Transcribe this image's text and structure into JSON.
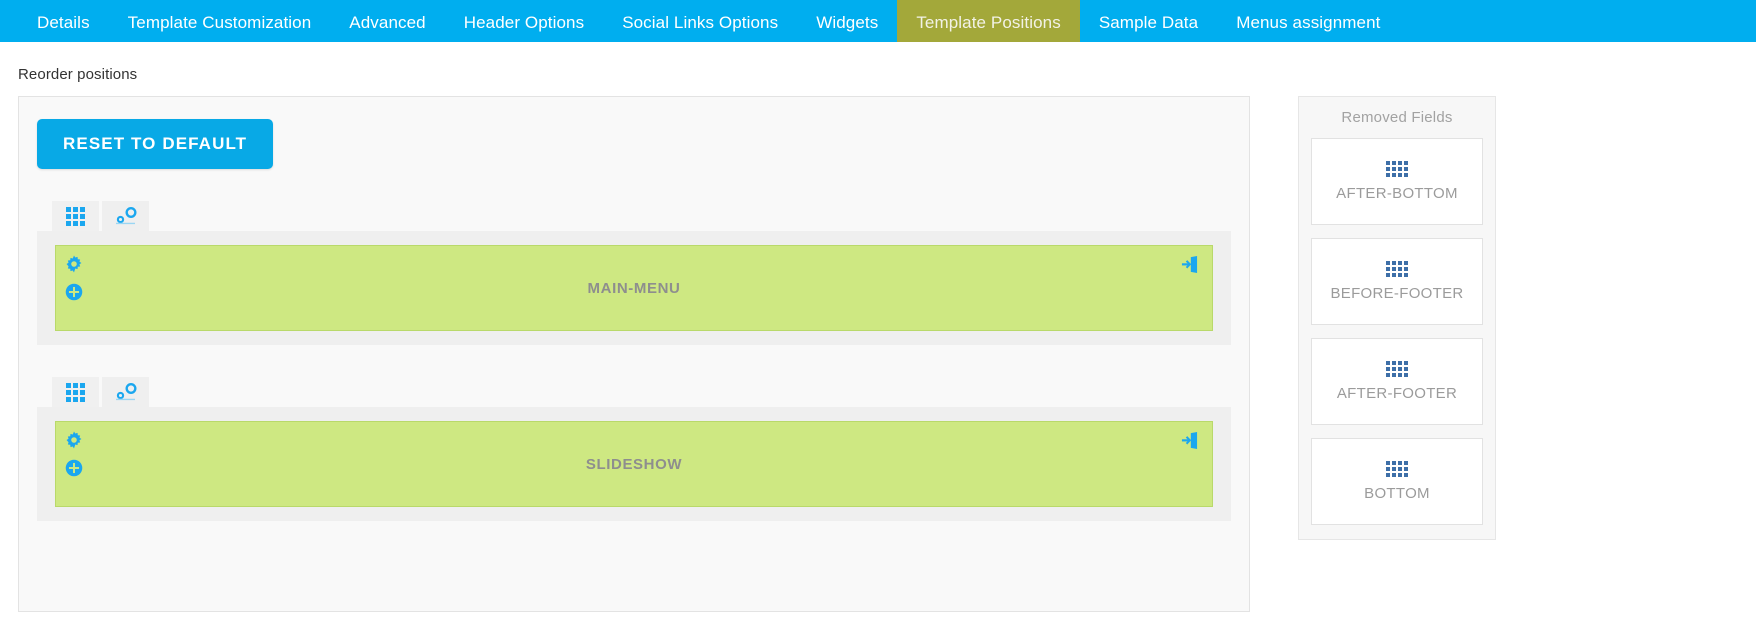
{
  "colors": {
    "tabbar_bg": "#00aeef",
    "tab_active_bg": "#a3a83a",
    "button_primary": "#08a9e6",
    "position_bar_bg": "#cee882",
    "icon_blue": "#1ba7ef",
    "card_icon_blue": "#3d6fa8"
  },
  "tabs": [
    {
      "label": "Details",
      "active": false
    },
    {
      "label": "Template Customization",
      "active": false
    },
    {
      "label": "Advanced",
      "active": false
    },
    {
      "label": "Header Options",
      "active": false
    },
    {
      "label": "Social Links Options",
      "active": false
    },
    {
      "label": "Widgets",
      "active": false
    },
    {
      "label": "Template Positions",
      "active": true
    },
    {
      "label": "Sample Data",
      "active": false
    },
    {
      "label": "Menus assignment",
      "active": false
    }
  ],
  "reorder": {
    "section_label": "Reorder positions",
    "reset_button": "RESET TO DEFAULT",
    "positions": [
      {
        "name": "MAIN-MENU",
        "tabs": [
          {
            "icon": "grid-icon",
            "selected": true
          },
          {
            "icon": "nodes-icon",
            "selected": false
          }
        ],
        "actions": [
          "gear-icon",
          "plus-circle-icon"
        ],
        "right_action": "sign-in-icon"
      },
      {
        "name": "SLIDESHOW",
        "tabs": [
          {
            "icon": "grid-icon",
            "selected": true
          },
          {
            "icon": "nodes-icon",
            "selected": false
          }
        ],
        "actions": [
          "gear-icon",
          "plus-circle-icon"
        ],
        "right_action": "sign-in-icon"
      }
    ]
  },
  "removed_fields": {
    "title": "Removed Fields",
    "cards": [
      {
        "label": "AFTER-BOTTOM",
        "icon": "grid-icon"
      },
      {
        "label": "BEFORE-FOOTER",
        "icon": "grid-icon"
      },
      {
        "label": "AFTER-FOOTER",
        "icon": "grid-icon"
      },
      {
        "label": "BOTTOM",
        "icon": "grid-icon"
      }
    ]
  }
}
